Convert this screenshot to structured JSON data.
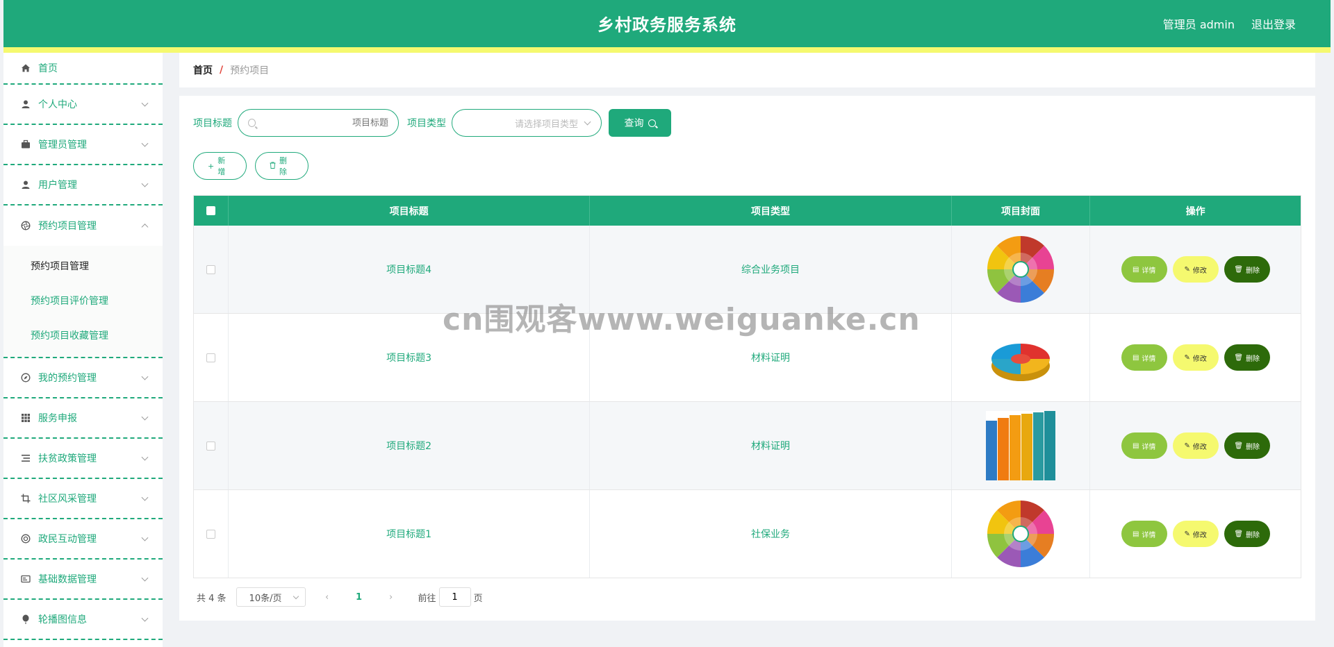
{
  "header": {
    "title": "乡村政务服务系统",
    "user_label": "管理员 admin",
    "logout_label": "退出登录"
  },
  "sidebar": {
    "items": [
      {
        "label": "首页",
        "icon": "home-icon"
      },
      {
        "label": "个人中心",
        "icon": "user-icon"
      },
      {
        "label": "管理员管理",
        "icon": "briefcase-icon"
      },
      {
        "label": "用户管理",
        "icon": "user-icon"
      },
      {
        "label": "预约项目管理",
        "icon": "aperture-icon",
        "expanded": true,
        "children": [
          {
            "label": "预约项目管理",
            "active": true
          },
          {
            "label": "预约项目评价管理"
          },
          {
            "label": "预约项目收藏管理"
          }
        ]
      },
      {
        "label": "我的预约管理",
        "icon": "compass-icon"
      },
      {
        "label": "服务申报",
        "icon": "grid-icon"
      },
      {
        "label": "扶贫政策管理",
        "icon": "list-icon"
      },
      {
        "label": "社区风采管理",
        "icon": "crop-icon"
      },
      {
        "label": "政民互动管理",
        "icon": "lifebuoy-icon"
      },
      {
        "label": "基础数据管理",
        "icon": "card-icon"
      },
      {
        "label": "轮播图信息",
        "icon": "balloon-icon"
      }
    ]
  },
  "breadcrumb": {
    "home": "首页",
    "separator": "/",
    "current": "预约项目"
  },
  "filters": {
    "title_label": "项目标题",
    "title_placeholder": "项目标题",
    "type_label": "项目类型",
    "type_placeholder": "请选择项目类型",
    "query_label": "查询"
  },
  "actions": {
    "add_label": "新增",
    "delete_label": "删除"
  },
  "table": {
    "columns": [
      "项目标题",
      "项目类型",
      "项目封面",
      "操作"
    ],
    "rows": [
      {
        "title": "项目标题4",
        "type": "综合业务项目",
        "cover": "wheel-chart"
      },
      {
        "title": "项目标题3",
        "type": "材料证明",
        "cover": "pie-3d"
      },
      {
        "title": "项目标题2",
        "type": "材料证明",
        "cover": "bar-columns"
      },
      {
        "title": "项目标题1",
        "type": "社保业务",
        "cover": "wheel-chart"
      }
    ],
    "op_labels": {
      "detail": "详情",
      "edit": "修改",
      "remove": "删除"
    }
  },
  "pagination": {
    "total_text": "共 4 条",
    "page_size": "10条/页",
    "current_page": "1",
    "goto_prefix": "前往",
    "goto_value": "1",
    "goto_suffix": "页"
  },
  "watermark": "cn围观客www.weiguanke.cn",
  "colors": {
    "primary": "#1fa97b",
    "stripe": "#f5f96f",
    "detail_btn": "#8ec63f",
    "edit_btn": "#f5f96f",
    "remove_btn": "#2d6a0a"
  }
}
